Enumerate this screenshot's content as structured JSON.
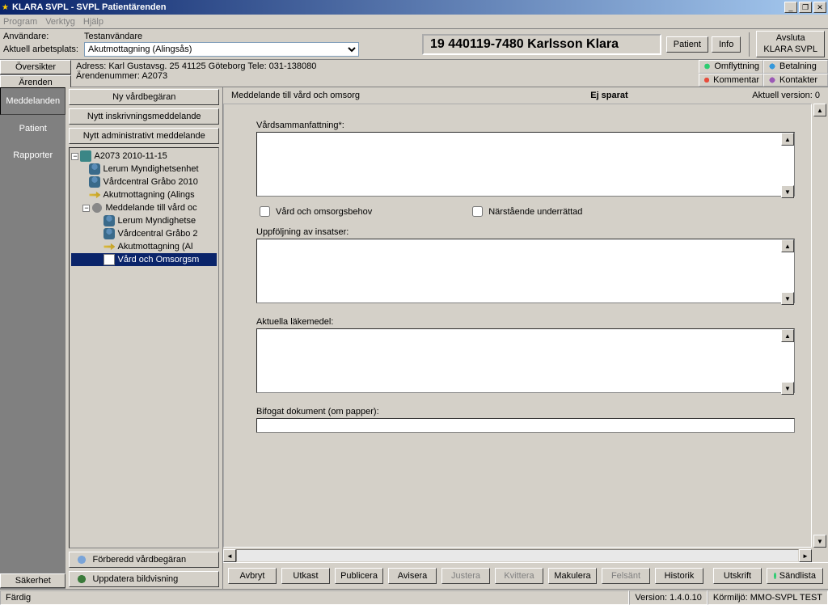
{
  "titlebar": {
    "text": "KLARA SVPL - SVPL Patientärenden"
  },
  "menu": {
    "program": "Program",
    "verktyg": "Verktyg",
    "hjalp": "Hjälp"
  },
  "userbar": {
    "anvandare_label": "Användare:",
    "anvandare_value": "Testanvändare",
    "arbetsplats_label": "Aktuell arbetsplats:",
    "arbetsplats_value": "Akutmottagning (Alingsås)",
    "patient_display": "19 440119-7480 Karlsson Klara",
    "patient_btn": "Patient",
    "info_btn": "Info",
    "avsluta_label": "Avsluta\nKLARA SVPL"
  },
  "addressbar": {
    "address": "Adress: Karl Gustavsg. 25  41125 Göteborg   Tele: 031-138080",
    "arendenummer": "Ärendenummer: A2073",
    "omflyttning": "Omflyttning",
    "betalning": "Betalning",
    "kommentar": "Kommentar",
    "kontakter": "Kontakter"
  },
  "sidebar": {
    "oversikter": "Översikter",
    "arenden": "Ärenden",
    "meddelanden": "Meddelanden",
    "patient": "Patient",
    "rapporter": "Rapporter",
    "sakerhet": "Säkerhet"
  },
  "leftpanel": {
    "ny_vardbegaran": "Ny vårdbegäran",
    "nytt_inskrivning": "Nytt inskrivningsmeddelande",
    "nytt_admin": "Nytt administrativt meddelande",
    "forberedd": "Förberedd vårdbegäran",
    "uppdatera": "Uppdatera bildvisning"
  },
  "tree": {
    "root": "A2073 2010-11-15",
    "n1": "Lerum Myndighetsenhet",
    "n2": "Vårdcentral Gråbo 2010",
    "n3": "Akutmottagning (Alings",
    "n4": "Meddelande till vård oc",
    "n5": "Lerum Myndighetse",
    "n6": "Vårdcentral Gråbo 2",
    "n7": "Akutmottagning (Al",
    "n8": "Vård och Omsorgsm"
  },
  "form": {
    "title": "Meddelande till vård och omsorg",
    "unsaved": "Ej sparat",
    "version_label": "Aktuell version: 0",
    "vardsammanfattning": "Vårdsammanfattning*:",
    "vard_omsorgsbehov": "Vård och omsorgsbehov",
    "narstaende": "Närstående underrättad",
    "uppfoljning": "Uppföljning av insatser:",
    "lakemedel": "Aktuella läkemedel:",
    "bifogat": "Bifogat dokument (om papper):"
  },
  "buttons": {
    "avbryt": "Avbryt",
    "utkast": "Utkast",
    "publicera": "Publicera",
    "avisera": "Avisera",
    "justera": "Justera",
    "kvittera": "Kvittera",
    "makulera": "Makulera",
    "felsant": "Felsänt",
    "historik": "Historik",
    "utskrift": "Utskrift",
    "sandlista": "Sändlista"
  },
  "status": {
    "fardig": "Färdig",
    "version": "Version: 1.4.0.10",
    "kormiljo": "Körmiljö: MMO-SVPL TEST"
  }
}
